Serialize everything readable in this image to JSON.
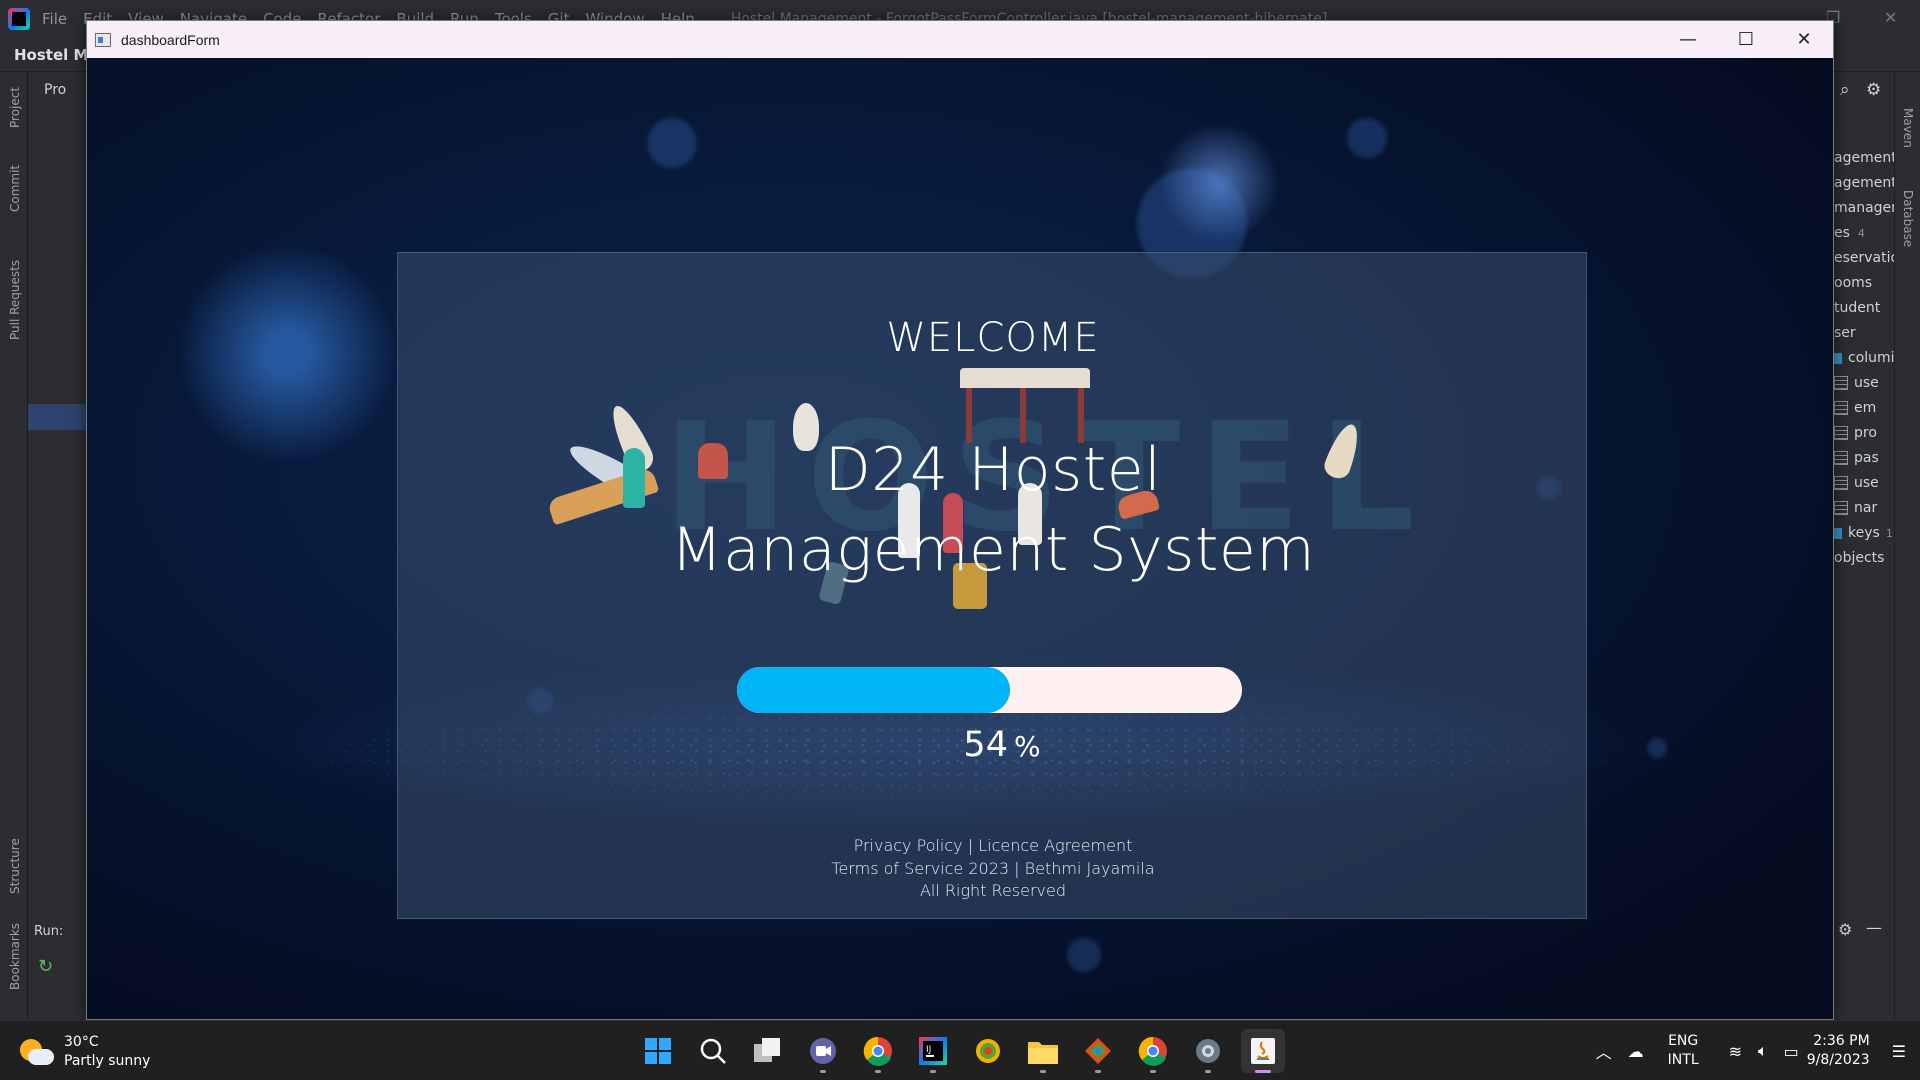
{
  "ide": {
    "menu": [
      "File",
      "Edit",
      "View",
      "Navigate",
      "Code",
      "Refactor",
      "Build",
      "Run",
      "Tools",
      "Git",
      "Window",
      "Help"
    ],
    "file_title": "Hostel Management - ForgotPassFormController.java [hostel-management-hibernate]",
    "project_name": "Hostel Ma",
    "project_tab": "Pro",
    "left_tools": [
      "Project",
      "Commit",
      "Pull Requests",
      "Structure",
      "Bookmarks"
    ],
    "run_label": "Run:",
    "right_tools": [
      "Maven",
      "Database"
    ],
    "db_tree": [
      {
        "label": "agement",
        "icon": "none"
      },
      {
        "label": "agement",
        "icon": "none"
      },
      {
        "label": "managem",
        "icon": "none"
      },
      {
        "label": "es",
        "count": "4",
        "icon": "none"
      },
      {
        "label": "eservatio",
        "icon": "none"
      },
      {
        "label": "ooms",
        "icon": "none"
      },
      {
        "label": "tudent",
        "icon": "none"
      },
      {
        "label": "ser",
        "icon": "none"
      },
      {
        "label": "columi",
        "icon": "folder"
      },
      {
        "label": "use",
        "icon": "key"
      },
      {
        "label": "em",
        "icon": "table"
      },
      {
        "label": "pro",
        "icon": "table"
      },
      {
        "label": "pas",
        "icon": "table"
      },
      {
        "label": "use",
        "icon": "table"
      },
      {
        "label": "nar",
        "icon": "table"
      },
      {
        "label": "keys",
        "count": "1",
        "icon": "folder"
      },
      {
        "label": "objects",
        "icon": "none"
      }
    ]
  },
  "window": {
    "title": "dashboardForm",
    "minimize_glyph": "—",
    "maximize_glyph": "☐",
    "close_glyph": "✕"
  },
  "app": {
    "welcome": "WELCOME",
    "title_line1": "D24 Hostel",
    "title_line2": "Management System",
    "hero_word": "HOSTEL",
    "progress_fraction": 0.54,
    "progress_value": "54",
    "progress_unit": "%",
    "footer": {
      "privacy": "Privacy Policy",
      "sep1": "|",
      "licence": "Licence Agreement",
      "terms": "Terms of Service 2023",
      "sep2": "|",
      "author": "Bethmi Jayamila",
      "rights": "All Right Reserved"
    },
    "colors": {
      "progress_fill": "#00b5f5",
      "progress_track": "#fff1f1"
    }
  },
  "taskbar": {
    "weather_temp": "30°C",
    "weather_desc": "Partly sunny",
    "apps": [
      "start-icon",
      "search-icon",
      "task-view-icon",
      "teams-icon",
      "chrome-icon",
      "intellij-icon",
      "app-icon",
      "file-explorer-icon",
      "git-icon",
      "chrome-icon",
      "settings-icon",
      "java-icon"
    ],
    "lang_line1": "ENG",
    "lang_line2": "INTL",
    "time": "2:36 PM",
    "date": "9/8/2023"
  }
}
